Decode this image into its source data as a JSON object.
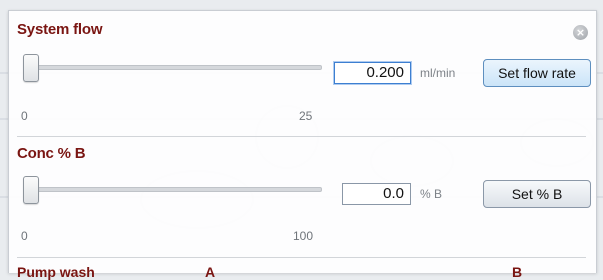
{
  "system_flow": {
    "title": "System flow",
    "slider_min": "0",
    "slider_max": "25",
    "value": "0.200",
    "unit": "ml/min",
    "button_label": "Set flow rate"
  },
  "conc_b": {
    "title": "Conc % B",
    "slider_min": "0",
    "slider_max": "100",
    "value": "0.0",
    "unit": "% B",
    "button_label": "Set % B"
  },
  "pump_wash": {
    "title": "Pump wash",
    "col_a": "A",
    "col_b": "B"
  },
  "icons": {
    "close": "close-icon"
  },
  "colors": {
    "section_title": "#7a1512",
    "focus_border": "#3d7fd1"
  }
}
